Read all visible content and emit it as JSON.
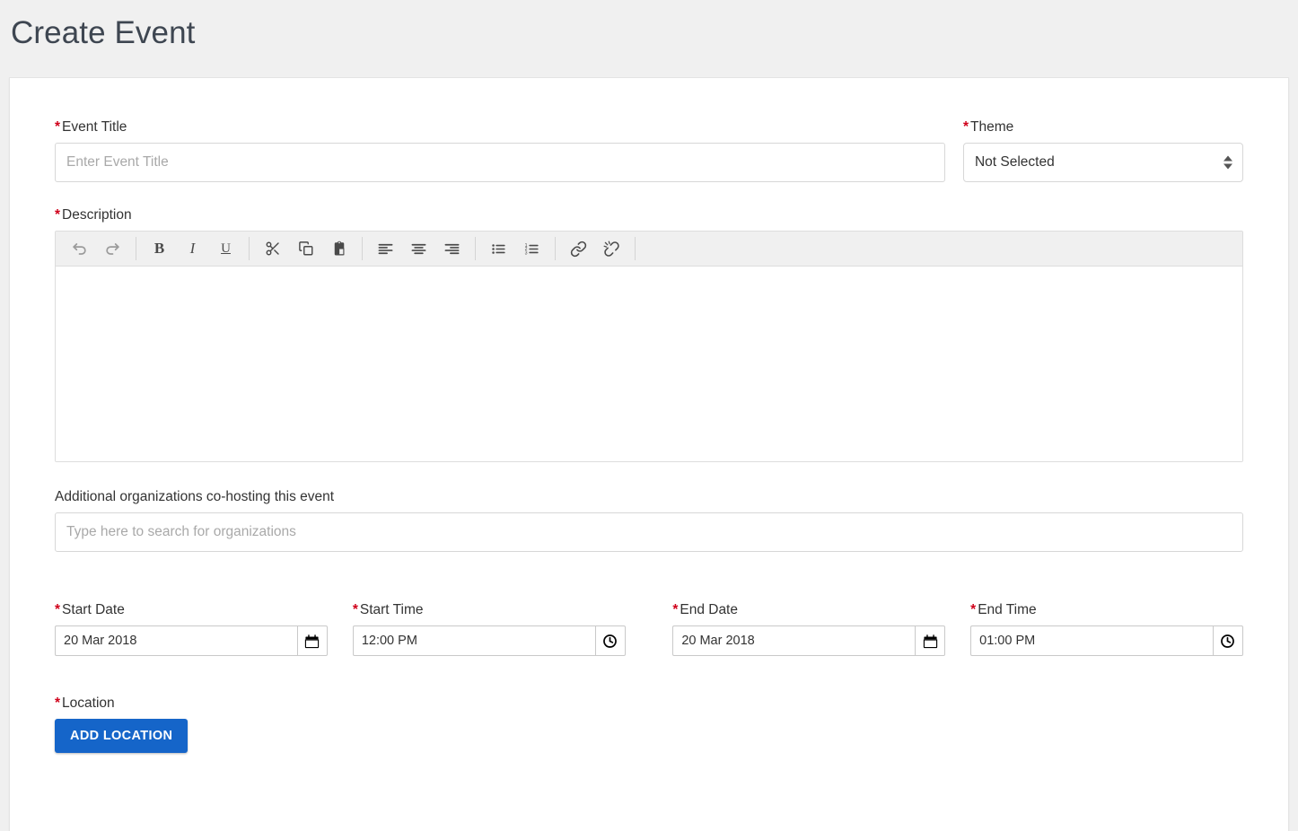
{
  "header": {
    "title": "Create Event"
  },
  "form": {
    "event_title": {
      "label": "Event Title",
      "required_marker": "*",
      "value": "",
      "placeholder": "Enter Event Title"
    },
    "theme": {
      "label": "Theme",
      "required_marker": "*",
      "selected": "Not Selected"
    },
    "description": {
      "label": "Description",
      "required_marker": "*",
      "content": "",
      "toolbar": [
        {
          "name": "undo-icon",
          "title": "Undo"
        },
        {
          "name": "redo-icon",
          "title": "Redo"
        },
        {
          "name": "bold-icon",
          "title": "Bold"
        },
        {
          "name": "italic-icon",
          "title": "Italic"
        },
        {
          "name": "underline-icon",
          "title": "Underline"
        },
        {
          "name": "cut-icon",
          "title": "Cut"
        },
        {
          "name": "copy-icon",
          "title": "Copy"
        },
        {
          "name": "paste-icon",
          "title": "Paste"
        },
        {
          "name": "align-left-icon",
          "title": "Align Left"
        },
        {
          "name": "align-center-icon",
          "title": "Align Center"
        },
        {
          "name": "align-right-icon",
          "title": "Align Right"
        },
        {
          "name": "bulleted-list-icon",
          "title": "Bulleted List"
        },
        {
          "name": "numbered-list-icon",
          "title": "Numbered List"
        },
        {
          "name": "link-icon",
          "title": "Insert Link"
        },
        {
          "name": "unlink-icon",
          "title": "Remove Link"
        }
      ]
    },
    "cohost": {
      "label": "Additional organizations co-hosting this event",
      "value": "",
      "placeholder": "Type here to search for organizations"
    },
    "start_date": {
      "label": "Start Date",
      "required_marker": "*",
      "value": "20 Mar 2018",
      "icon": "calendar-icon"
    },
    "start_time": {
      "label": "Start Time",
      "required_marker": "*",
      "value": "12:00 PM",
      "icon": "clock-icon"
    },
    "end_date": {
      "label": "End Date",
      "required_marker": "*",
      "value": "20 Mar 2018",
      "icon": "calendar-icon"
    },
    "end_time": {
      "label": "End Time",
      "required_marker": "*",
      "value": "01:00 PM",
      "icon": "clock-icon"
    },
    "location": {
      "label": "Location",
      "required_marker": "*",
      "add_button_label": "ADD LOCATION"
    }
  },
  "colors": {
    "page_background": "#f0f0f0",
    "card_background": "#ffffff",
    "required_asterisk": "#d0021b",
    "primary_button": "#1565c9",
    "toolbar_background": "#f0f0f0",
    "border": "#d7d7d7",
    "title_text": "#3e4651"
  }
}
